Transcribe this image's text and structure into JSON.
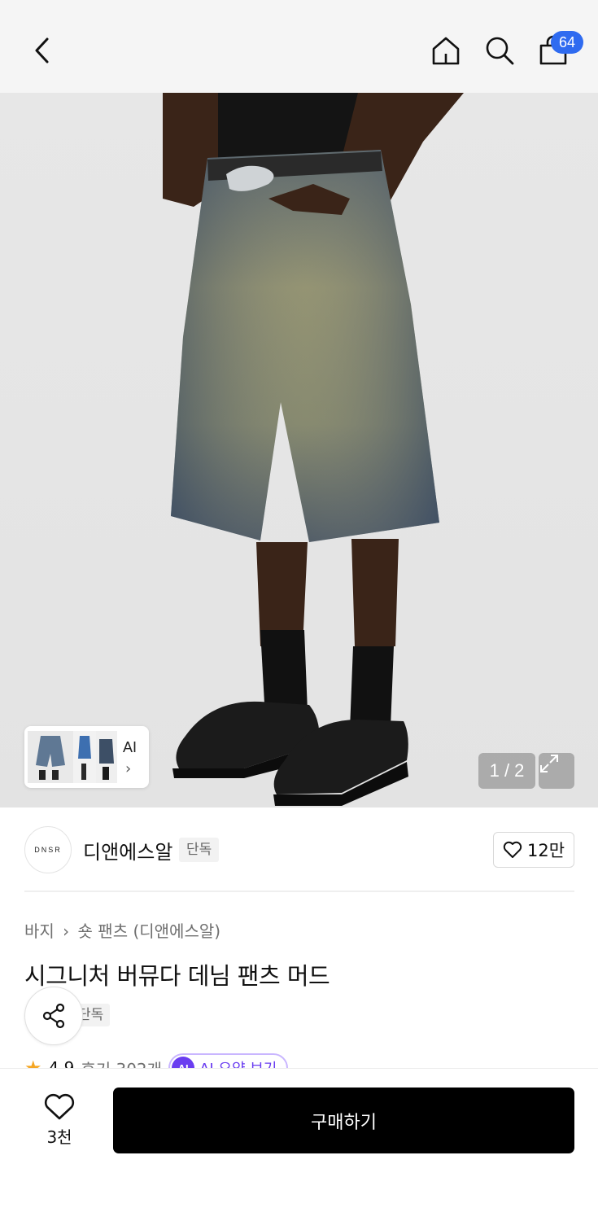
{
  "header": {
    "cart_count": "64",
    "icons": [
      "chevron-left-icon",
      "home-icon",
      "search-icon",
      "shopping-bag-icon"
    ]
  },
  "gallery": {
    "ai_label": "AI",
    "pager": "1 / 2"
  },
  "brand": {
    "logo_text": "DNSR",
    "name": "디앤에스알",
    "tag": "단독",
    "likes": "12만"
  },
  "product": {
    "breadcrumb": [
      "바지",
      "숏 팬츠 (디앤에스알)"
    ],
    "title": "시그니처 버뮤다 데님 팬츠 머드",
    "tag": "단독",
    "rating": "4.9",
    "reviews": "후기 302개",
    "ai_summary_badge": "AI",
    "ai_summary": "AI 요약 보기"
  },
  "bottom_bar": {
    "wish_count": "3천",
    "buy_label": "구매하기"
  },
  "colors": {
    "accent_blue": "#2f6bf0",
    "ai_purple": "#6a3df0",
    "star": "#f5a623",
    "buy_button": "#000000"
  }
}
